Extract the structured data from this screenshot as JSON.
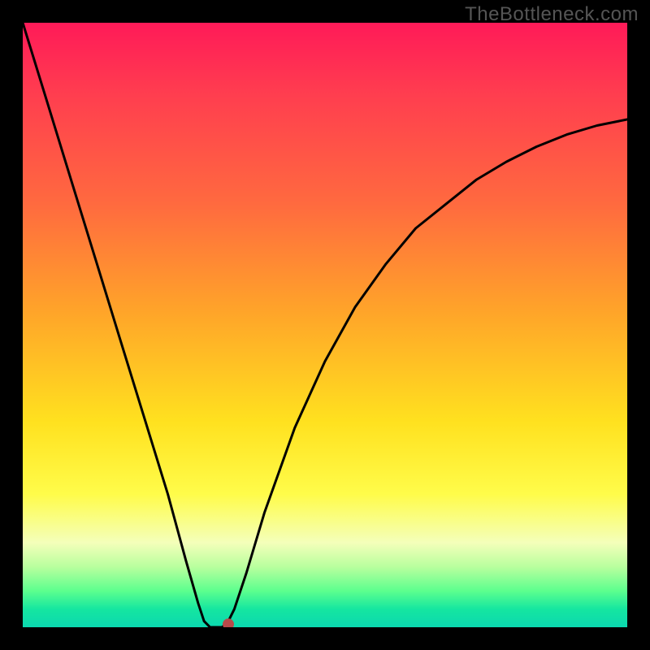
{
  "watermark": "TheBottleneck.com",
  "chart_data": {
    "type": "line",
    "title": "",
    "xlabel": "",
    "ylabel": "",
    "xlim": [
      0,
      100
    ],
    "ylim": [
      0,
      100
    ],
    "series": [
      {
        "name": "curve",
        "x": [
          0,
          4,
          8,
          12,
          16,
          20,
          24,
          27,
          29,
          30,
          31,
          32,
          33,
          34,
          35,
          37,
          40,
          45,
          50,
          55,
          60,
          65,
          70,
          75,
          80,
          85,
          90,
          95,
          100
        ],
        "y": [
          100,
          87,
          74,
          61,
          48,
          35,
          22,
          11,
          4,
          1,
          0,
          0,
          0,
          1,
          3,
          9,
          19,
          33,
          44,
          53,
          60,
          66,
          70,
          74,
          77,
          79.5,
          81.5,
          83,
          84
        ]
      }
    ],
    "marker": {
      "x": 34,
      "y": 0.5
    },
    "background_gradient": {
      "stops": [
        {
          "pos": 0.0,
          "color": "#ff1a58"
        },
        {
          "pos": 0.12,
          "color": "#ff3e4f"
        },
        {
          "pos": 0.3,
          "color": "#ff6a3f"
        },
        {
          "pos": 0.48,
          "color": "#ffa529"
        },
        {
          "pos": 0.66,
          "color": "#ffe11f"
        },
        {
          "pos": 0.78,
          "color": "#fffc4a"
        },
        {
          "pos": 0.86,
          "color": "#f4ffba"
        },
        {
          "pos": 0.9,
          "color": "#b9ff9e"
        },
        {
          "pos": 0.94,
          "color": "#5cff8e"
        },
        {
          "pos": 0.97,
          "color": "#15e6a0"
        },
        {
          "pos": 1.0,
          "color": "#0bd8b0"
        }
      ]
    },
    "marker_color": "#b74a4a"
  }
}
